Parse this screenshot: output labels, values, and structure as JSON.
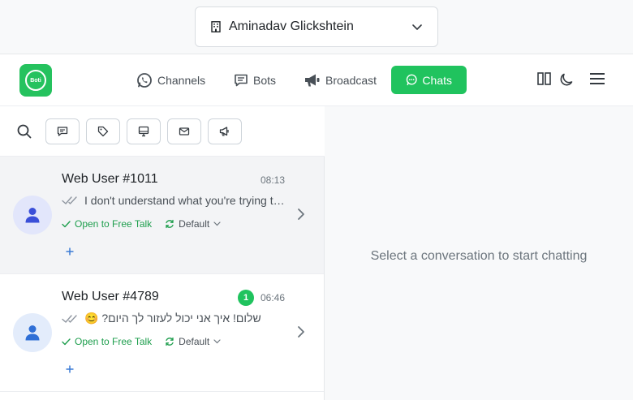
{
  "org": {
    "name": "Aminadav Glickshtein"
  },
  "logo": {
    "text": "Boti"
  },
  "nav": {
    "channels": "Channels",
    "bots": "Bots",
    "broadcast": "Broadcast",
    "chats": "Chats"
  },
  "colors": {
    "brand": "#20c35e",
    "accent_text": "#1e9e4d",
    "avatar_bg": "#e2e6fb"
  },
  "conversations": [
    {
      "name": "Web User #1011",
      "time": "08:13",
      "unread": "",
      "message": "I don't understand what you're trying t…",
      "status": "Open to Free Talk",
      "queue": "Default"
    },
    {
      "name": "Web User #4789",
      "time": "06:46",
      "unread": "1",
      "message": "שלום! איך אני יכול לעזור לך היום? 😊",
      "status": "Open to Free Talk",
      "queue": "Default"
    }
  ],
  "empty_state": "Select a conversation to start chatting"
}
